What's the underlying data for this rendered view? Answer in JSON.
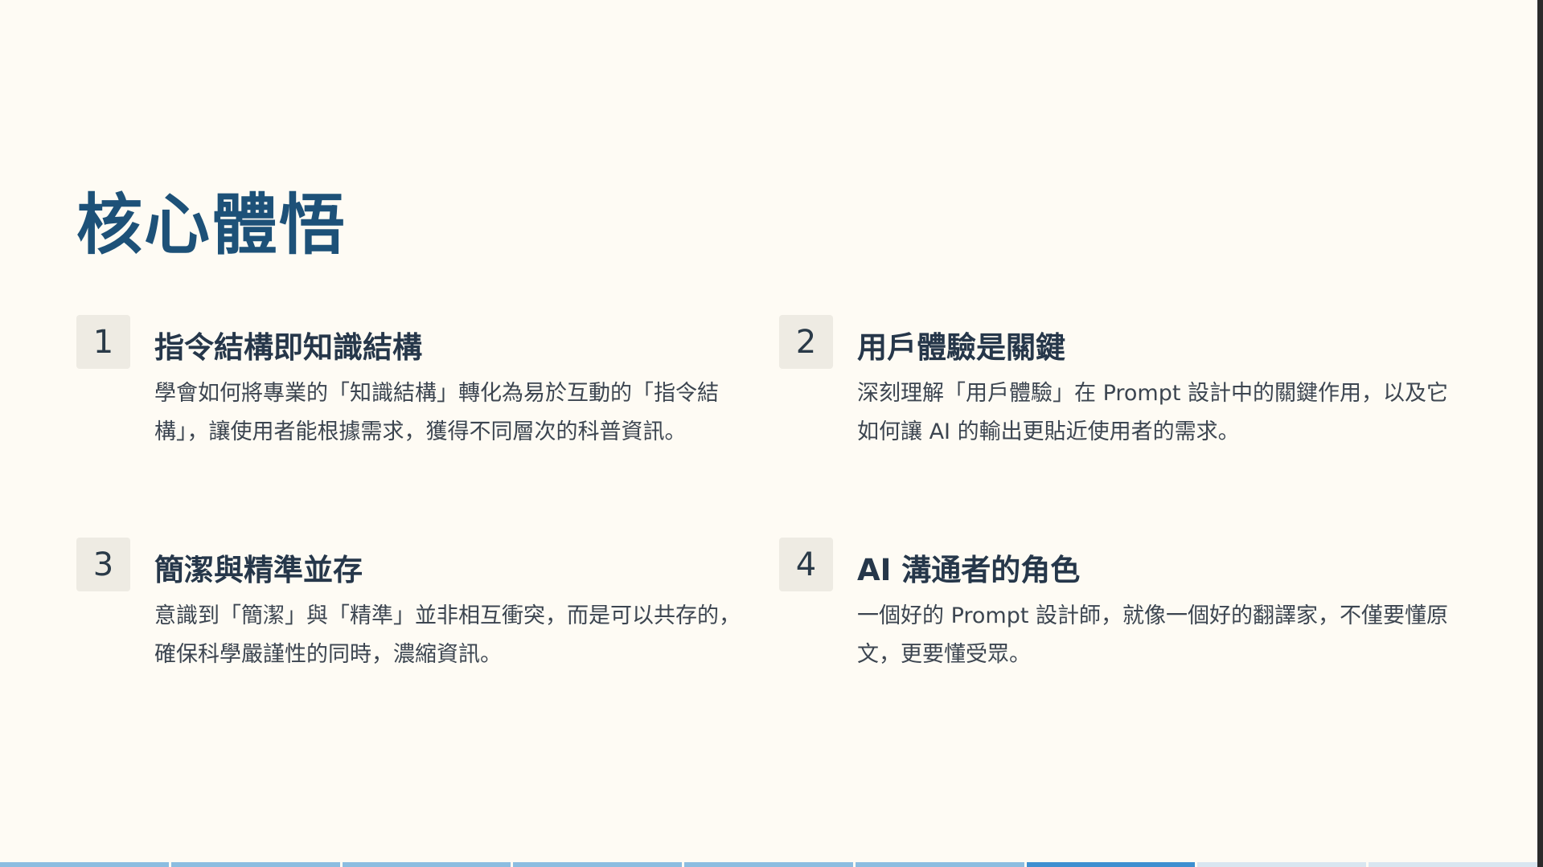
{
  "slide": {
    "title": "核心體悟",
    "items": [
      {
        "number": "1",
        "title": "指令結構即知識結構",
        "description": "學會如何將專業的「知識結構」轉化為易於互動的「指令結構」，讓使用者能根據需求，獲得不同層次的科普資訊。"
      },
      {
        "number": "2",
        "title": "用戶體驗是關鍵",
        "description": "深刻理解「用戶體驗」在 Prompt 設計中的關鍵作用，以及它如何讓 AI 的輸出更貼近使用者的需求。"
      },
      {
        "number": "3",
        "title": "簡潔與精準並存",
        "description": "意識到「簡潔」與「精準」並非相互衝突，而是可以共存的，確保科學嚴謹性的同時，濃縮資訊。"
      },
      {
        "number": "4",
        "title": "AI 溝通者的角色",
        "description": "一個好的 Prompt 設計師，就像一個好的翻譯家，不僅要懂原文，更要懂受眾。"
      }
    ]
  },
  "progress": {
    "total_segments": 9,
    "current_segment": 7
  },
  "colors": {
    "background": "#fefbf4",
    "title": "#1d5178",
    "accent_progress": "#3d8fd0"
  }
}
